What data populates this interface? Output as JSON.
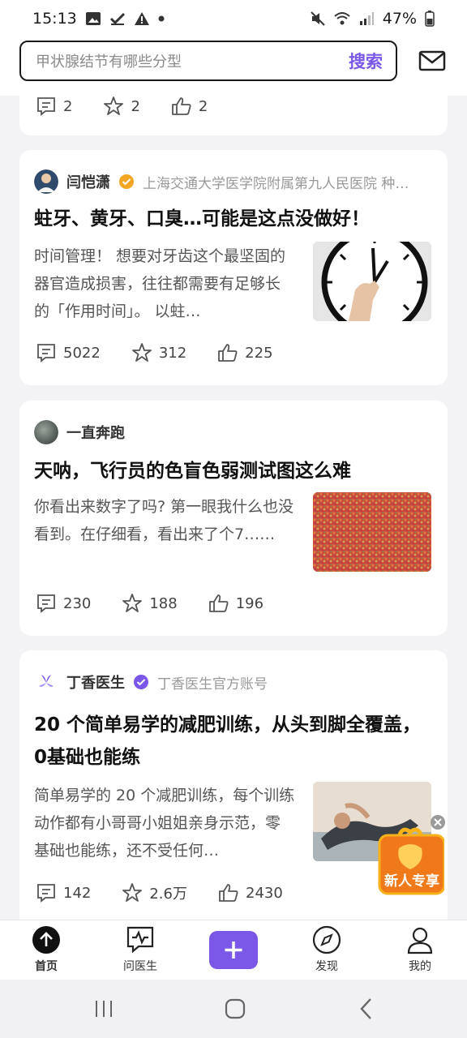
{
  "status_bar": {
    "time": "15:13",
    "battery": "47%"
  },
  "search": {
    "placeholder": "甲状腺结节有哪些分型",
    "button": "搜索"
  },
  "cards": [
    {
      "stats": {
        "comments": "2",
        "favorites": "2",
        "likes": "2"
      }
    },
    {
      "author": "闫恺潇",
      "author_sub": "上海交通大学医学院附属第九人民医院 种…",
      "title": "蛀牙、黄牙、口臭…可能是这点没做好！",
      "excerpt": "时间管理！ 想要对牙齿这个最坚固的器官造成损害，往往都需要有足够长的「作用时间」。 以蛀…",
      "stats": {
        "comments": "5022",
        "favorites": "312",
        "likes": "225"
      }
    },
    {
      "author": "一直奔跑",
      "title": "天呐，飞行员的色盲色弱测试图这么难",
      "excerpt": "你看出来数字了吗? 第一眼我什么也没看到。在仔细看，看出来了个7……",
      "stats": {
        "comments": "230",
        "favorites": "188",
        "likes": "196"
      }
    },
    {
      "author": "丁香医生",
      "author_sub": "丁香医生官方账号",
      "title": "20 个简单易学的减肥训练，从头到脚全覆盖，0基础也能练",
      "excerpt": "简单易学的 20 个减肥训练，每个训练动作都有小哥哥小姐姐亲身示范，零基础也能练，还不受任何…",
      "stats": {
        "comments": "142",
        "favorites": "2.6万",
        "likes": "2430"
      }
    }
  ],
  "promo": {
    "label": "新人专享"
  },
  "bottom_nav": [
    {
      "label": "首页"
    },
    {
      "label": "问医生"
    },
    {
      "label": ""
    },
    {
      "label": "发现"
    },
    {
      "label": "我的"
    }
  ],
  "colors": {
    "accent": "#7b57e8",
    "promo": "#f07a1a"
  }
}
